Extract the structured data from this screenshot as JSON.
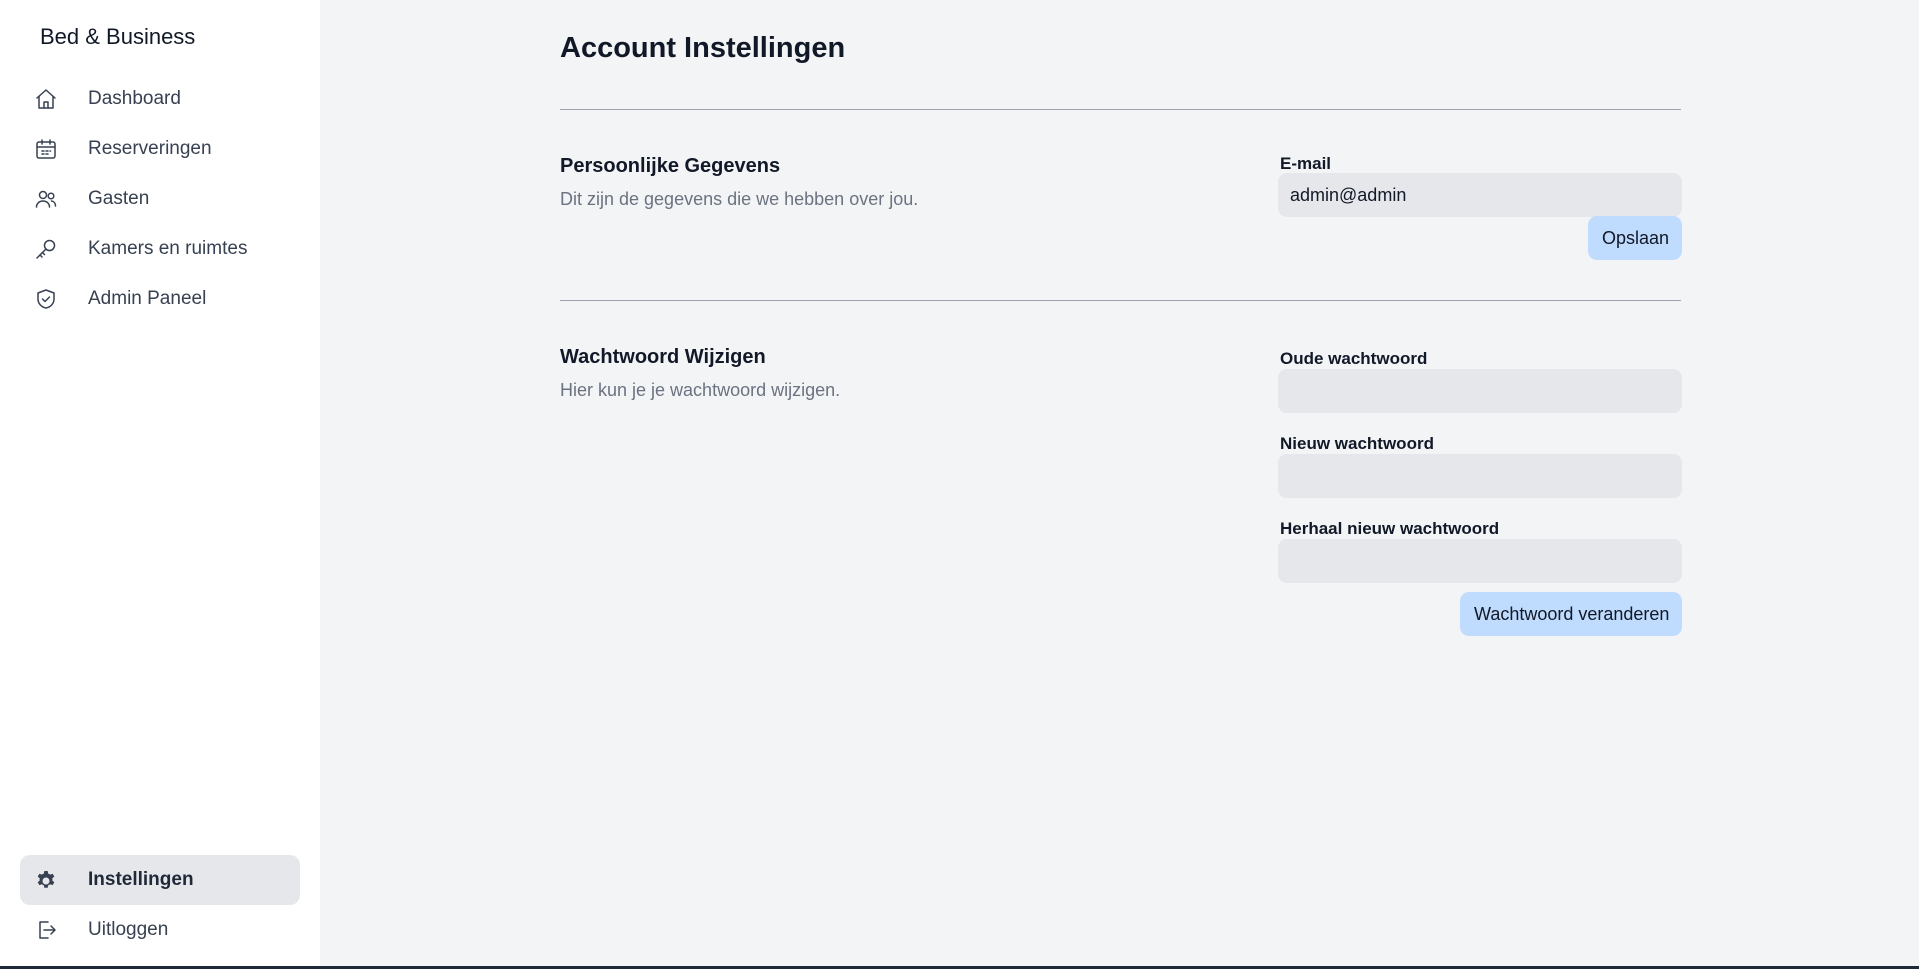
{
  "app": {
    "brand": "Bed & Business"
  },
  "sidebar": {
    "items": [
      {
        "label": "Dashboard",
        "icon": "home-icon"
      },
      {
        "label": "Reserveringen",
        "icon": "calendar-icon"
      },
      {
        "label": "Gasten",
        "icon": "users-icon"
      },
      {
        "label": "Kamers en ruimtes",
        "icon": "key-icon"
      },
      {
        "label": "Admin Paneel",
        "icon": "shield-check-icon"
      }
    ],
    "bottom_items": [
      {
        "label": "Instellingen",
        "icon": "gear-icon",
        "active": true
      },
      {
        "label": "Uitloggen",
        "icon": "logout-icon"
      }
    ]
  },
  "main": {
    "title": "Account Instellingen",
    "personal": {
      "title": "Persoonlijke Gegevens",
      "description": "Dit zijn de gegevens die we hebben over jou.",
      "email_label": "E-mail",
      "email_value": "admin@admin",
      "save_label": "Opslaan"
    },
    "password": {
      "title": "Wachtwoord Wijzigen",
      "description": "Hier kun je je wachtwoord wijzigen.",
      "old_label": "Oude wachtwoord",
      "new_label": "Nieuw wachtwoord",
      "repeat_label": "Herhaal nieuw wachtwoord",
      "submit_label": "Wachtwoord veranderen"
    }
  },
  "colors": {
    "background": "#f3f4f6",
    "sidebar": "#ffffff",
    "input": "#e5e7eb",
    "button": "#bfdbfe",
    "active_nav": "#e5e7eb"
  }
}
